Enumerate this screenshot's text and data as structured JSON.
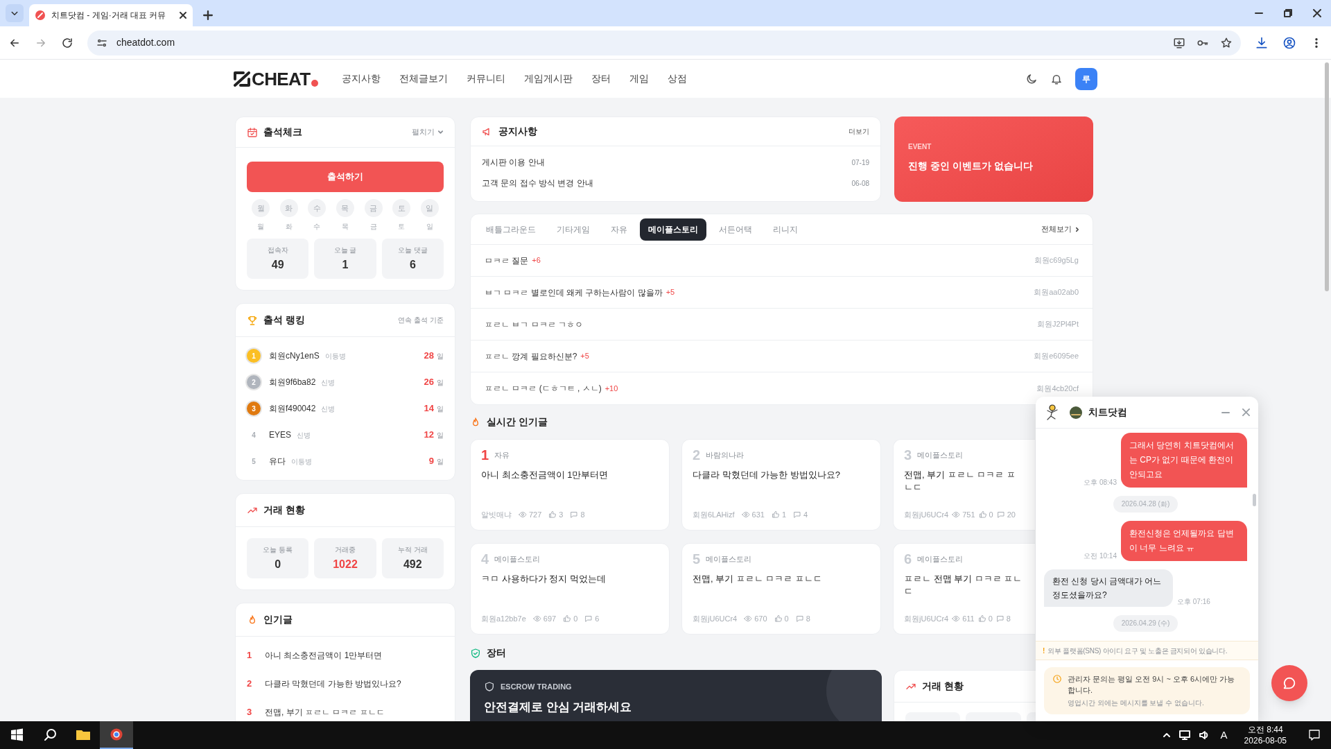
{
  "browser": {
    "tab_title": "치트닷컴 - 게임·거래 대표 커뮤",
    "url": "cheatdot.com"
  },
  "site_header": {
    "logo": "CHEAT",
    "nav": [
      "공지사항",
      "전체글보기",
      "커뮤니티",
      "게임게시판",
      "장터",
      "게임",
      "상점"
    ],
    "avatar": "루"
  },
  "attendance": {
    "title": "출석체크",
    "toggle": "펼치기",
    "button": "출석하기",
    "days": [
      {
        "label": "월",
        "caption": "월",
        "checked": false
      },
      {
        "label": "화",
        "caption": "화",
        "checked": false
      },
      {
        "label": "수",
        "caption": "수",
        "checked": false
      },
      {
        "label": "목",
        "caption": "목",
        "checked": false
      },
      {
        "label": "금",
        "caption": "금",
        "checked": false
      },
      {
        "label": "토",
        "caption": "토",
        "checked": false
      },
      {
        "label": "일",
        "caption": "일",
        "checked": false
      }
    ],
    "stats": [
      {
        "label": "접속자",
        "value": "49",
        "highlight": false
      },
      {
        "label": "오늘 글",
        "value": "1",
        "highlight": false
      },
      {
        "label": "오늘 댓글",
        "value": "6",
        "highlight": false
      }
    ]
  },
  "ranking": {
    "title": "출석 랭킹",
    "note": "연속 출석 기준",
    "rows": [
      {
        "rank": "1",
        "color": "#fbbf24",
        "name": "회원cNy1enS",
        "grade": "이등병",
        "days": "28",
        "unit": "일"
      },
      {
        "rank": "2",
        "color": "#b0b5bd",
        "name": "회원9f6ba82",
        "grade": "신병",
        "days": "26",
        "unit": "일"
      },
      {
        "rank": "3",
        "color": "#e07a10",
        "name": "회원f490042",
        "grade": "신병",
        "days": "14",
        "unit": "일"
      },
      {
        "rank": "4",
        "name": "EYES",
        "grade": "신병",
        "days": "12",
        "unit": "일"
      },
      {
        "rank": "5",
        "name": "유다",
        "grade": "이등병",
        "days": "9",
        "unit": "일"
      }
    ]
  },
  "trade_status": {
    "title": "거래 현황",
    "stats": [
      {
        "label": "오늘 등록",
        "value": "0",
        "highlight": false
      },
      {
        "label": "거래중",
        "value": "1022",
        "highlight": true
      },
      {
        "label": "누적 거래",
        "value": "492",
        "highlight": false
      }
    ]
  },
  "popular": {
    "title": "인기글",
    "items": [
      {
        "rank": "1",
        "title": "아니 최소충전금액이 1만부터면"
      },
      {
        "rank": "2",
        "title": "다클라 막혔던데 가능한 방법있나요?"
      },
      {
        "rank": "3",
        "title": "전맵, 부기 ㅍㄹㄴ ㅁㅋㄹ ㅍㄴㄷ"
      }
    ]
  },
  "notices": {
    "title": "공지사항",
    "more": "더보기",
    "items": [
      {
        "title": "게시판 이용 안내",
        "date": "07-19"
      },
      {
        "title": "고객 문의 접수 방식 변경 안내",
        "date": "06-08"
      }
    ]
  },
  "event": {
    "label": "EVENT",
    "message": "진행 중인 이벤트가 없습니다"
  },
  "board": {
    "tabs": [
      {
        "label": "배틀그라운드",
        "selected": false
      },
      {
        "label": "기타게임",
        "selected": false
      },
      {
        "label": "자유",
        "selected": false
      },
      {
        "label": "메이플스토리",
        "selected": true
      },
      {
        "label": "서든어택",
        "selected": false
      },
      {
        "label": "리니지",
        "selected": false
      }
    ],
    "view_all": "전체보기",
    "rows": [
      {
        "title": "ㅁㅋㄹ 질문",
        "comments": "+6",
        "author": "회원c69g5Lg"
      },
      {
        "title": "ㅂㄱ ㅁㅋㄹ 별로인데 왜케 구하는사람이 많을까",
        "comments": "+5",
        "author": "회원aa02ab0"
      },
      {
        "title": "ㅍㄹㄴ ㅂㄱ ㅁㅋㄹ ㄱㅎㅇ",
        "author": "회원J2Pl4Pt"
      },
      {
        "title": "ㅍㄹㄴ 깡계 필요하신분?",
        "comments": "+5",
        "author": "회원e6095ee"
      },
      {
        "title": "ㅍㄹㄴ ㅁㅋㄹ (ㄷㅎㄱㅌ , ㅅㄴ)",
        "comments": "+10",
        "author": "회원4cb20cf"
      }
    ]
  },
  "realtime": {
    "title": "실시간 인기글",
    "cards": [
      {
        "rank": "1",
        "top": true,
        "category": "자유",
        "title": "아니 최소충전금액이 1만부터면",
        "author": "알빗매냐",
        "views": "727",
        "likes": "3",
        "comments": "8"
      },
      {
        "rank": "2",
        "top": false,
        "category": "바람의나라",
        "title": "다클라 막혔던데 가능한 방법있나요?",
        "author": "회원6LAHizf",
        "views": "631",
        "likes": "1",
        "comments": "4"
      },
      {
        "rank": "3",
        "top": false,
        "category": "메이플스토리",
        "title": "전맵, 부기 ㅍㄹㄴ ㅁㅋㄹ ㅍㄴㄷ",
        "author": "회원jU6UCr4",
        "views": "751",
        "likes": "0",
        "comments": "20"
      },
      {
        "rank": "4",
        "top": false,
        "category": "메이플스토리",
        "title": "ㅋㅁ 사용하다가 정지 먹었는데",
        "author": "회원a12bb7e",
        "views": "697",
        "likes": "0",
        "comments": "6"
      },
      {
        "rank": "5",
        "top": false,
        "category": "메이플스토리",
        "title": "전맵, 부기 ㅍㄹㄴ ㅁㅋㄹ ㅍㄴㄷ",
        "author": "회원jU6UCr4",
        "views": "670",
        "likes": "0",
        "comments": "8"
      },
      {
        "rank": "6",
        "top": false,
        "category": "메이플스토리",
        "title": "ㅍㄹㄴ 전맵 부기 ㅁㅋㄹ ㅍㄴㄷ",
        "author": "회원jU6UCr4",
        "views": "611",
        "likes": "0",
        "comments": "8"
      }
    ]
  },
  "market": {
    "title": "장터",
    "escrow_label": "ESCROW TRADING",
    "escrow_title": "안전결제로 안심 거래하세요",
    "trade_title": "거래 현황"
  },
  "chat": {
    "title": "치트닷컴",
    "messages": [
      {
        "kind": "sent",
        "text": "그래서 당연히 치트닷컴에서는 CP가 없기 때문에 환전이 안되고요",
        "time": "오후 08:43"
      },
      {
        "kind": "date",
        "text": "2026.04.28 (화)"
      },
      {
        "kind": "sent",
        "text": "환전신청은 언제될까요 답변이 너무 느려요 ㅠ",
        "time": "오전 10:14"
      },
      {
        "kind": "received",
        "text": "환전 신청 당시 금액대가 어느정도셨을까요?",
        "time": "오후 07:16"
      },
      {
        "kind": "date",
        "text": "2026.04.29 (수)"
      }
    ],
    "warning_mark": "!",
    "warning": "외부 플랫폼(SNS) 아이디 요구 및 노출은 금지되어 있습니다.",
    "hours_title": "관리자 문의는 평일 오전 9시 ~ 오후 6시에만 가능합니다.",
    "hours_note": "영업시간 외에는 메시지를 보낼 수 없습니다."
  },
  "taskbar": {
    "ime": "A",
    "time": "오전 8:44",
    "date": "2026-08-05"
  }
}
